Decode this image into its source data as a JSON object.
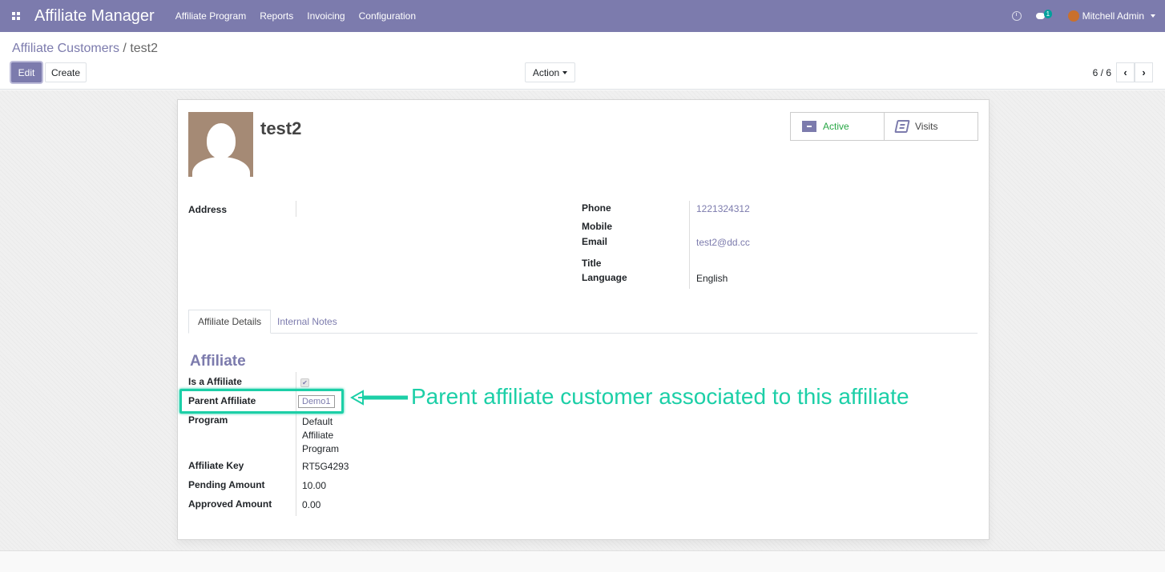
{
  "navbar": {
    "app_name": "Affiliate Manager",
    "menu": [
      "Affiliate Program",
      "Reports",
      "Invoicing",
      "Configuration"
    ],
    "chat_count": "1",
    "user_name": "Mitchell Admin"
  },
  "breadcrumb": {
    "parent": "Affiliate Customers",
    "separator": " / ",
    "current": "test2"
  },
  "buttons": {
    "edit": "Edit",
    "create": "Create",
    "action": "Action"
  },
  "pager": {
    "value": "6 / 6"
  },
  "record": {
    "name": "test2",
    "stat_active": "Active",
    "stat_visits": "Visits",
    "address_label": "Address",
    "phone_label": "Phone",
    "phone": "1221324312",
    "mobile_label": "Mobile",
    "email_label": "Email",
    "email": "test2@dd.cc",
    "title_label": "Title",
    "language_label": "Language",
    "language": "English"
  },
  "tabs": [
    "Affiliate Details",
    "Internal Notes"
  ],
  "affiliate": {
    "section_title": "Affiliate",
    "is_affiliate_label": "Is a Affiliate",
    "is_affiliate": true,
    "parent_label": "Parent Affiliate",
    "parent_value": "Demo1",
    "program_label": "Program",
    "program_lines": [
      "Default",
      "Affiliate",
      "Program"
    ],
    "key_label": "Affiliate Key",
    "key": "RT5G4293",
    "pending_label": "Pending Amount",
    "pending": "10.00",
    "approved_label": "Approved Amount",
    "approved": "0.00"
  },
  "annotation": {
    "text": "Parent affiliate customer associated to this affiliate",
    "color": "#1ccfa7"
  },
  "colors": {
    "brand": "#7c7bad",
    "active": "#28a745"
  }
}
